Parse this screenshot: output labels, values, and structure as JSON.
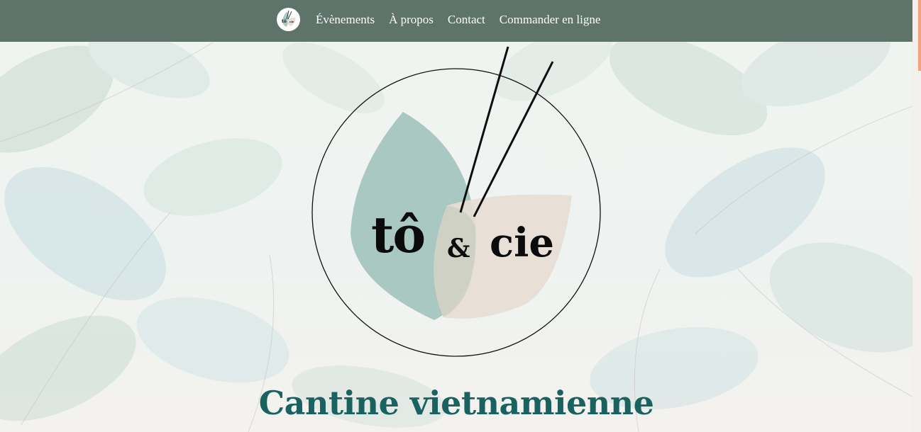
{
  "nav": {
    "logo_alt": "tô & cie",
    "links": [
      {
        "label": "Évènements"
      },
      {
        "label": "À propos"
      },
      {
        "label": "Contact"
      },
      {
        "label": "Commander en ligne"
      }
    ]
  },
  "hero": {
    "brand_to": "tô",
    "brand_amp": "&",
    "brand_cie": "cie",
    "subtitle": "Cantine vietnamienne"
  },
  "colors": {
    "navbar": "#5e736a",
    "subtitle": "#19625f",
    "leaf_green": "#a9c8c1",
    "leaf_beige": "#e7ded5",
    "scroll_thumb": "#f2a27c"
  }
}
